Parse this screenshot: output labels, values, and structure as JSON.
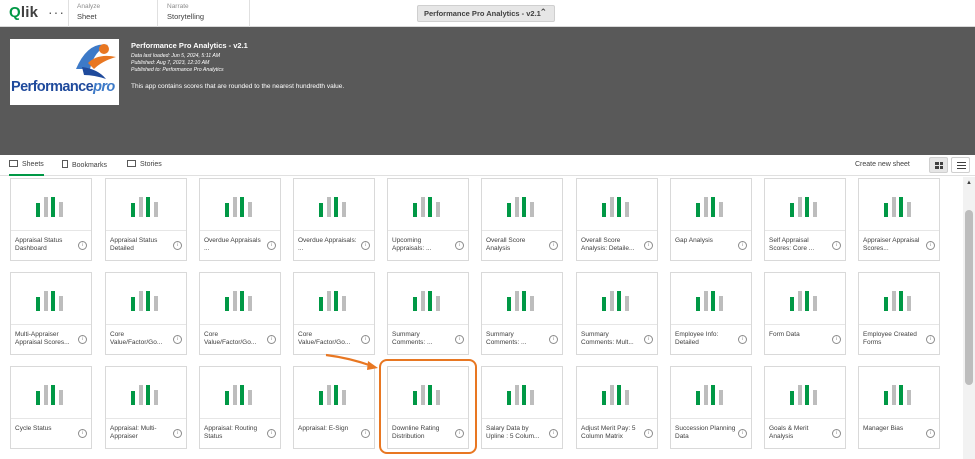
{
  "topbar": {
    "logo_text": "lik",
    "logo_q": "Q",
    "menu_dots": "···",
    "analyze_small": "Analyze",
    "analyze_big": "Sheet",
    "narrate_small": "Narrate",
    "narrate_big": "Storytelling",
    "app_title": "Performance Pro Analytics - v2.1",
    "chevron": "⌃"
  },
  "banner": {
    "thumbnail_text": "Performance",
    "thumbnail_text_pro": "pro",
    "title": "Performance Pro Analytics - v2.1",
    "data_loaded": "Data last loaded: Jun 5, 2024, 5:11 AM",
    "published": "Published: Aug 7, 2023, 12:10 AM",
    "published_to": "Published to: Performance Pro Analytics",
    "description": "This app contains scores that are rounded to the nearest hundredth value."
  },
  "tabs": {
    "sheets": "Sheets",
    "bookmarks": "Bookmarks",
    "stories": "Stories",
    "create_new_sheet": "Create new sheet"
  },
  "colors": {
    "green": "#009845",
    "gray": "#bdbdbd",
    "highlight": "#e87722"
  },
  "sheets": [
    {
      "label": "Appraisal Status Dashboard"
    },
    {
      "label": "Appraisal Status Detailed"
    },
    {
      "label": "Overdue Appraisals ..."
    },
    {
      "label": "Overdue Appraisals: ..."
    },
    {
      "label": "Upcoming Appraisals: ..."
    },
    {
      "label": "Overall Score Analysis"
    },
    {
      "label": "Overall Score Analysis: Detaile..."
    },
    {
      "label": "Gap Analysis"
    },
    {
      "label": "Self Appraisal Scores: Core ..."
    },
    {
      "label": "Appraiser Appraisal Scores..."
    },
    {
      "label": "Multi-Appraiser Appraisal Scores..."
    },
    {
      "label": "Core Value/Factor/Go..."
    },
    {
      "label": "Core Value/Factor/Go..."
    },
    {
      "label": "Core Value/Factor/Go..."
    },
    {
      "label": "Summary Comments: ..."
    },
    {
      "label": "Summary Comments: ..."
    },
    {
      "label": "Summary Comments: Mult..."
    },
    {
      "label": "Employee Info: Detailed"
    },
    {
      "label": "Form Data"
    },
    {
      "label": "Employee Created Forms"
    },
    {
      "label": "Cycle Status"
    },
    {
      "label": "Appraisal: Multi-Appraiser"
    },
    {
      "label": "Appraisal: Routing Status"
    },
    {
      "label": "Appraisal: E-Sign"
    },
    {
      "label": "Downline Rating Distribution"
    },
    {
      "label": "Salary Data by Upline : 5 Colum..."
    },
    {
      "label": "Adjust Merit Pay: 5 Column Matrix"
    },
    {
      "label": "Succession Planning Data"
    },
    {
      "label": "Goals & Merit Analysis"
    },
    {
      "label": "Manager Bias"
    }
  ],
  "info_glyph": "i",
  "scroll_up": "▲"
}
